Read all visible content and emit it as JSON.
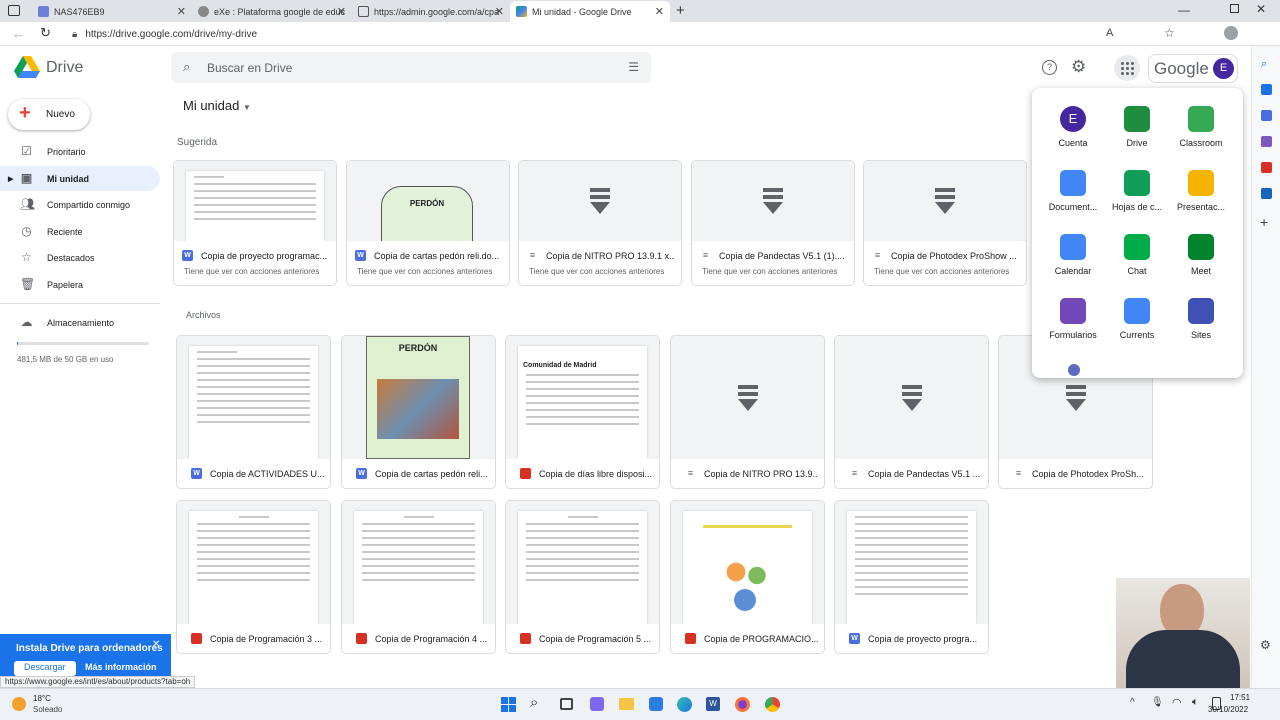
{
  "browser": {
    "tabs": [
      {
        "title": "NAS476EB9"
      },
      {
        "title": "eXe : Plataforma google de educ"
      },
      {
        "title": "https://admin.google.com/a/cpa"
      },
      {
        "title": "Mi unidad - Google Drive"
      }
    ],
    "url": "https://drive.google.com/drive/my-drive"
  },
  "header": {
    "brand": "Drive",
    "search_placeholder": "Buscar en Drive",
    "google_word": "Google",
    "avatar_letter": "E"
  },
  "sidebar": {
    "new_label": "Nuevo",
    "items": [
      {
        "label": "Prioritario",
        "icon": "check-circle-icon"
      },
      {
        "label": "Mi unidad",
        "icon": "my-drive-icon"
      },
      {
        "label": "Compartido conmigo",
        "icon": "people-icon"
      },
      {
        "label": "Reciente",
        "icon": "clock-icon"
      },
      {
        "label": "Destacados",
        "icon": "star-icon"
      },
      {
        "label": "Papelera",
        "icon": "trash-icon"
      },
      {
        "label": "Almacenamiento",
        "icon": "cloud-icon"
      }
    ],
    "storage_text": "481,5 MB de 50 GB en uso",
    "storage_used_fraction": 0.01
  },
  "main": {
    "title": "Mi unidad",
    "suggested_label": "Sugerida",
    "files_label": "Archivos",
    "suggested": [
      {
        "name": "Copia de proyecto programac...",
        "sub": "Tiene que ver con acciones anteriores",
        "type": "word"
      },
      {
        "name": "Copia de cartas pedón reli.do...",
        "sub": "Tiene que ver con acciones anteriores",
        "type": "word"
      },
      {
        "name": "Copia de NITRO PRO 13.9.1 x...",
        "sub": "Tiene que ver con acciones anteriores",
        "type": "file"
      },
      {
        "name": "Copia de Pandectas V5.1 (1)....",
        "sub": "Tiene que ver con acciones anteriores",
        "type": "file"
      },
      {
        "name": "Copia de Photodex ProShow ...",
        "sub": "Tiene que ver con acciones anteriores",
        "type": "file"
      }
    ],
    "files": [
      {
        "name": "Copia de ACTIVIDADES U...",
        "type": "word"
      },
      {
        "name": "Copia de cartas pedón reli...",
        "type": "word"
      },
      {
        "name": "Copia de días libre disposi...",
        "type": "pdf"
      },
      {
        "name": "Copia de NITRO PRO 13.9...",
        "type": "file"
      },
      {
        "name": "Copia de Pandectas V5.1 ...",
        "type": "file"
      },
      {
        "name": "Copia de Photodex ProSh...",
        "type": "file"
      },
      {
        "name": "Copia de Programación 3 ...",
        "type": "pdf"
      },
      {
        "name": "Copia de Programación 4 ...",
        "type": "pdf"
      },
      {
        "name": "Copia de Programación 5 ...",
        "type": "pdf"
      },
      {
        "name": "Copia de PROGRAMACIO...",
        "type": "pdf"
      },
      {
        "name": "Copia de proyecto progra...",
        "type": "word"
      }
    ],
    "thumb_texts": {
      "perdon": "PERDÓN",
      "comunidad": "Comunidad de Madrid"
    }
  },
  "apps_panel": {
    "apps": [
      {
        "label": "Cuenta",
        "color": "#4527a0"
      },
      {
        "label": "Drive",
        "color": "#1e8e3e"
      },
      {
        "label": "Classroom",
        "color": "#34a853"
      },
      {
        "label": "Document...",
        "color": "#4285f4"
      },
      {
        "label": "Hojas de c...",
        "color": "#0f9d58"
      },
      {
        "label": "Presentac...",
        "color": "#f4b400"
      },
      {
        "label": "Calendar",
        "color": "#4285f4"
      },
      {
        "label": "Chat",
        "color": "#00ac47"
      },
      {
        "label": "Meet",
        "color": "#00832d"
      },
      {
        "label": "Formularios",
        "color": "#7248b9"
      },
      {
        "label": "Currents",
        "color": "#4285f4"
      },
      {
        "label": "Sites",
        "color": "#3f51b5"
      }
    ]
  },
  "banner": {
    "title": "Instala Drive para ordenadores",
    "download": "Descargar",
    "more": "Más información"
  },
  "status_url": "https://www.google.es/intl/es/about/products?tab=oh",
  "taskbar": {
    "temp": "18°C",
    "weather": "Soleado",
    "time": "17:51",
    "date": "30/10/2022"
  }
}
